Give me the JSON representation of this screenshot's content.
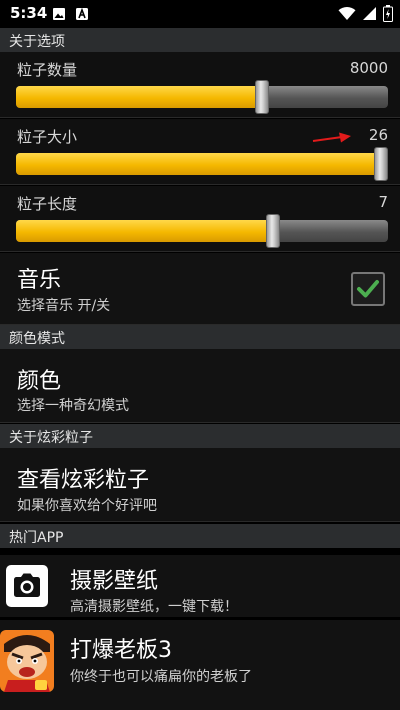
{
  "status_bar": {
    "time": "5:34"
  },
  "sections": {
    "about_options": "关于选项",
    "color_mode": "颜色模式",
    "about_particles": "关于炫彩粒子",
    "hot_apps": "热门APP"
  },
  "sliders": [
    {
      "label": "粒子数量",
      "value": "8000",
      "fill_fraction": 0.66
    },
    {
      "label": "粒子大小",
      "value": "26",
      "fill_fraction": 0.98
    },
    {
      "label": "粒子长度",
      "value": "7",
      "fill_fraction": 0.69
    }
  ],
  "music": {
    "title": "音乐",
    "summary": "选择音乐 开/关",
    "checked": true
  },
  "color": {
    "title": "颜色",
    "summary": "选择一种奇幻模式"
  },
  "view_particles": {
    "title": "查看炫彩粒子",
    "summary": "如果你喜欢给个好评吧"
  },
  "apps": [
    {
      "title": "摄影壁纸",
      "subtitle": "高清摄影壁纸，一键下载！",
      "icon": "camera-icon"
    },
    {
      "title": "打爆老板3",
      "subtitle": "你终于也可以痛扁你的老板了",
      "icon": "angry-boss-icon"
    }
  ],
  "colors": {
    "accent": "#f5b800",
    "check": "#4caf50",
    "annotation_arrow": "#e21b1b"
  }
}
